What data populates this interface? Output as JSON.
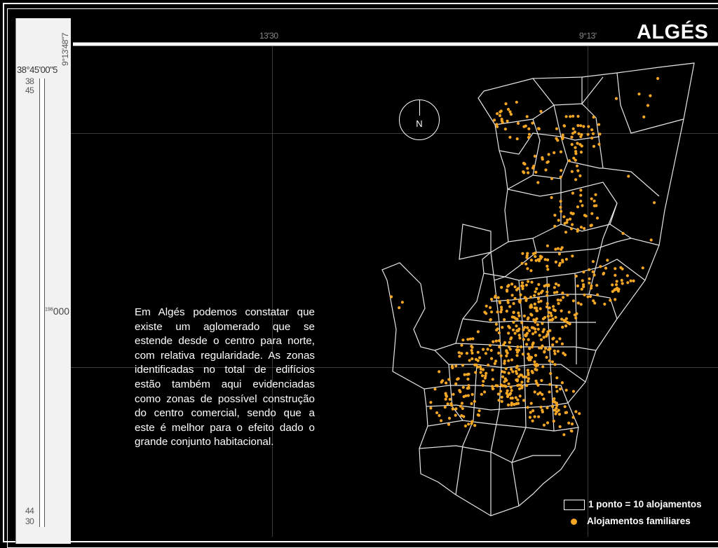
{
  "map": {
    "title": "ALGÉS",
    "description": "Em Algés podemos constatar que  existe um aglomerado que se estende desde o centro para norte, com relativa regularidade. As zonas identificadas no total de edifícios estão também aqui evidenciadas como zonas de possível construção do centro comercial, sendo que a este é melhor para o efeito dado o grande conjunto habitacional.",
    "north_label": "N",
    "legend": {
      "boundary_label": "1 ponto = 10 alojamentos",
      "dot_label": "Alojamentos familiares",
      "dot_color": "#f5a623"
    },
    "coordinates": {
      "top_left": "13'30",
      "top_right": "9°13'",
      "corner_lon": "9°13'48\"7",
      "corner_lat": "38°45'00\"5",
      "lat_38": "38",
      "lat_45": "45",
      "side_prefix": "198",
      "side_value": "000",
      "bottom_44": "44",
      "bottom_30": "30"
    }
  }
}
